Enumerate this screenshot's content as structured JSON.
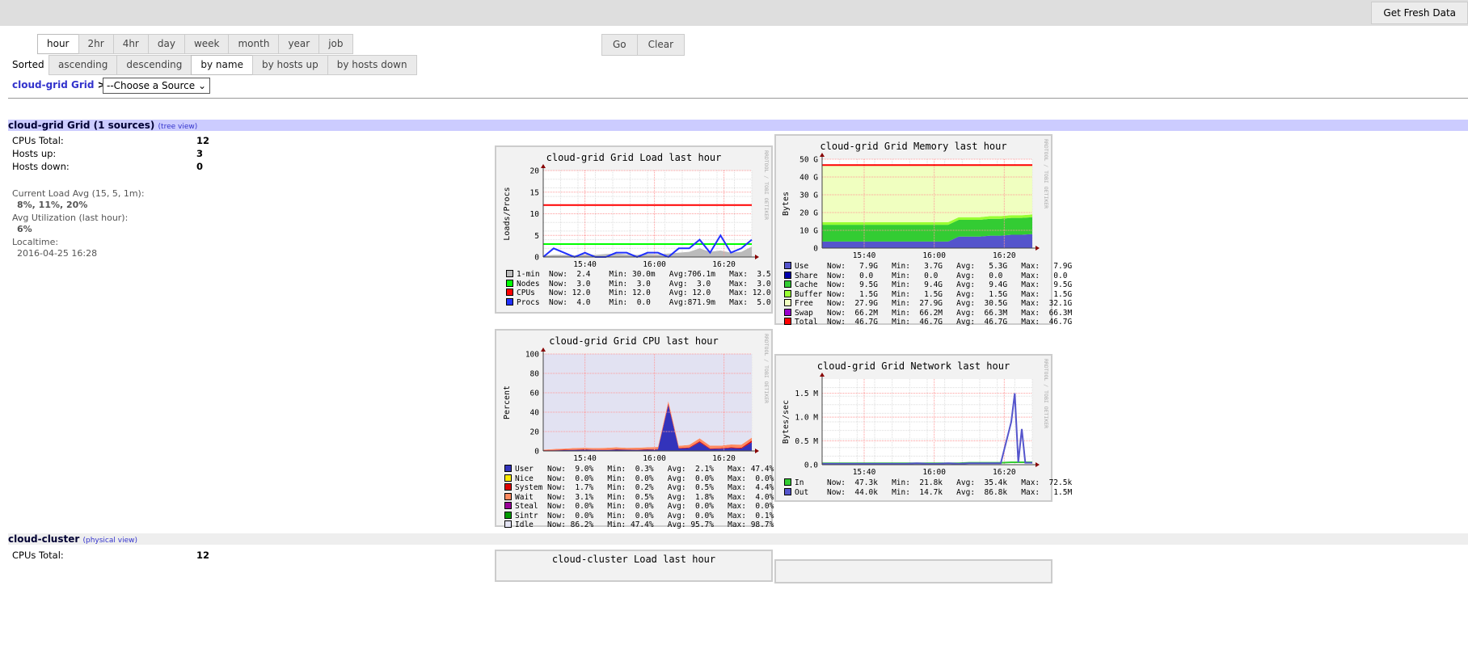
{
  "header": {
    "fresh_label": "Get Fresh Data"
  },
  "time_tabs": [
    "hour",
    "2hr",
    "4hr",
    "day",
    "week",
    "month",
    "year",
    "job"
  ],
  "time_selected": "hour",
  "go_label": "Go",
  "clear_label": "Clear",
  "sort": {
    "label": "Sorted",
    "options": [
      "ascending",
      "descending",
      "by name",
      "by hosts up",
      "by hosts down"
    ],
    "selected": "by name"
  },
  "breadcrumb": {
    "grid": "cloud-grid Grid",
    "sep": ">",
    "source_select": "--Choose a Source"
  },
  "grid_section": {
    "title": "cloud-grid Grid (1 sources)",
    "link": "(tree view)",
    "cpus_label": "CPUs Total:",
    "cpus": "12",
    "up_label": "Hosts up:",
    "up": "3",
    "down_label": "Hosts down:",
    "down": "0",
    "load_label": "Current Load Avg (15, 5, 1m):",
    "load": "8%, 11%, 20%",
    "util_label": "Avg Utilization (last hour):",
    "util": "6%",
    "time_label": "Localtime:",
    "time": "2016-04-25 16:28"
  },
  "cluster_section": {
    "title": "cloud-cluster",
    "link": "(physical view)",
    "cpus_label": "CPUs Total:",
    "cpus": "12",
    "chart_title": "cloud-cluster Load last hour"
  },
  "watermark": "RRDTOOL / TOBI OETIKER",
  "chart_data": [
    {
      "type": "line",
      "title": "cloud-grid Grid Load last hour",
      "ylabel": "Loads/Procs",
      "ylim": [
        0,
        20
      ],
      "yticks": [
        {
          "v": 0,
          "l": "0"
        },
        {
          "v": 5,
          "l": "5"
        },
        {
          "v": 10,
          "l": "10"
        },
        {
          "v": 15,
          "l": "15"
        },
        {
          "v": 20,
          "l": "20"
        }
      ],
      "xlim": [
        "15:28",
        "16:28"
      ],
      "xticks": [
        "15:40",
        "16:00",
        "16:20"
      ],
      "x": [
        "15:28",
        "15:31",
        "15:34",
        "15:37",
        "15:40",
        "15:43",
        "15:46",
        "15:49",
        "15:52",
        "15:55",
        "15:58",
        "16:01",
        "16:04",
        "16:07",
        "16:10",
        "16:13",
        "16:16",
        "16:19",
        "16:22",
        "16:25",
        "16:28"
      ],
      "series": [
        {
          "name": "1-min",
          "color": "#bbbbbb",
          "kind": "area",
          "values": [
            0.3,
            0.5,
            0.5,
            0.4,
            0.6,
            0.5,
            0.7,
            0.8,
            0.6,
            0.5,
            0.7,
            0.6,
            0.8,
            1.0,
            1.2,
            2.0,
            1.2,
            1.5,
            1.0,
            1.2,
            2.4
          ],
          "legend": "1-min  Now:  2.4    Min: 30.0m   Avg:706.1m   Max:  3.5"
        },
        {
          "name": "Nodes",
          "color": "#00ff00",
          "kind": "line",
          "values": [
            3,
            3,
            3,
            3,
            3,
            3,
            3,
            3,
            3,
            3,
            3,
            3,
            3,
            3,
            3,
            3,
            3,
            3,
            3,
            3,
            3
          ],
          "legend": "Nodes  Now:  3.0    Min:  3.0    Avg:  3.0    Max:  3.0"
        },
        {
          "name": "CPUs",
          "color": "#ff0000",
          "kind": "line",
          "values": [
            12,
            12,
            12,
            12,
            12,
            12,
            12,
            12,
            12,
            12,
            12,
            12,
            12,
            12,
            12,
            12,
            12,
            12,
            12,
            12,
            12
          ],
          "legend": "CPUs   Now: 12.0    Min: 12.0    Avg: 12.0    Max: 12.0"
        },
        {
          "name": "Procs",
          "color": "#2030ff",
          "kind": "line",
          "values": [
            0,
            2,
            1,
            0,
            1,
            0,
            0,
            1,
            1,
            0,
            1,
            1,
            0,
            2,
            2,
            4,
            1,
            5,
            1,
            2,
            4
          ],
          "legend": "Procs  Now:  4.0    Min:  0.0    Avg:871.9m   Max:  5.0"
        }
      ]
    },
    {
      "type": "area",
      "title": "cloud-grid Grid Memory last hour",
      "ylabel": "Bytes",
      "ylim": [
        0,
        50
      ],
      "yticks": [
        {
          "v": 0,
          "l": "0"
        },
        {
          "v": 10,
          "l": "10 G"
        },
        {
          "v": 20,
          "l": "20 G"
        },
        {
          "v": 30,
          "l": "30 G"
        },
        {
          "v": 40,
          "l": "40 G"
        },
        {
          "v": 50,
          "l": "50 G"
        }
      ],
      "xlim": [
        "15:28",
        "16:28"
      ],
      "xticks": [
        "15:40",
        "16:00",
        "16:20"
      ],
      "x": [
        "15:28",
        "15:31",
        "15:34",
        "15:37",
        "15:40",
        "15:43",
        "15:46",
        "15:49",
        "15:52",
        "15:55",
        "15:58",
        "16:01",
        "16:04",
        "16:07",
        "16:10",
        "16:13",
        "16:16",
        "16:19",
        "16:22",
        "16:25",
        "16:28"
      ],
      "series": [
        {
          "name": "Use",
          "color": "#5555cc",
          "kind": "stack",
          "values": [
            3.7,
            3.7,
            3.7,
            3.7,
            3.7,
            3.7,
            3.7,
            3.7,
            3.7,
            3.7,
            3.7,
            3.7,
            3.7,
            6.5,
            6.5,
            6.5,
            7.0,
            7.0,
            7.5,
            7.5,
            7.9
          ],
          "legend": "Use    Now:   7.9G   Min:   3.7G   Avg:   5.3G   Max:   7.9G"
        },
        {
          "name": "Share",
          "color": "#0000aa",
          "kind": "stack",
          "values": [
            0,
            0,
            0,
            0,
            0,
            0,
            0,
            0,
            0,
            0,
            0,
            0,
            0,
            0,
            0,
            0,
            0,
            0,
            0,
            0,
            0
          ],
          "legend": "Share  Now:   0.0    Min:   0.0    Avg:   0.0    Max:   0.0"
        },
        {
          "name": "Cache",
          "color": "#33cc33",
          "kind": "stack",
          "values": [
            9.4,
            9.4,
            9.4,
            9.4,
            9.4,
            9.4,
            9.4,
            9.4,
            9.4,
            9.4,
            9.4,
            9.4,
            9.4,
            9.4,
            9.4,
            9.4,
            9.5,
            9.5,
            9.5,
            9.5,
            9.5
          ],
          "legend": "Cache  Now:   9.5G   Min:   9.4G   Avg:   9.4G   Max:   9.5G"
        },
        {
          "name": "Buffer",
          "color": "#99ff33",
          "kind": "stack",
          "values": [
            1.5,
            1.5,
            1.5,
            1.5,
            1.5,
            1.5,
            1.5,
            1.5,
            1.5,
            1.5,
            1.5,
            1.5,
            1.5,
            1.5,
            1.5,
            1.5,
            1.5,
            1.5,
            1.5,
            1.5,
            1.5
          ],
          "legend": "Buffer Now:   1.5G   Min:   1.5G   Avg:   1.5G   Max:   1.5G"
        },
        {
          "name": "Free",
          "color": "#f0ffc0",
          "kind": "stack",
          "values": [
            32.1,
            32.1,
            32.1,
            32.1,
            32.1,
            32.1,
            32.1,
            32.1,
            32.1,
            32.1,
            32.1,
            32.1,
            32.1,
            29.3,
            29.3,
            29.3,
            28.7,
            28.7,
            28.2,
            28.2,
            27.9
          ],
          "legend": "Free   Now:  27.9G   Min:  27.9G   Avg:  30.5G   Max:  32.1G"
        },
        {
          "name": "Swap",
          "color": "#9900cc",
          "kind": "stack",
          "values": [
            0,
            0,
            0,
            0,
            0,
            0,
            0,
            0,
            0,
            0,
            0,
            0,
            0,
            0,
            0,
            0,
            0,
            0,
            0,
            0,
            0
          ],
          "legend": "Swap   Now:  66.2M   Min:  66.2M   Avg:  66.3M   Max:  66.3M"
        },
        {
          "name": "Total",
          "color": "#ff0000",
          "kind": "line",
          "values": [
            46.7,
            46.7,
            46.7,
            46.7,
            46.7,
            46.7,
            46.7,
            46.7,
            46.7,
            46.7,
            46.7,
            46.7,
            46.7,
            46.7,
            46.7,
            46.7,
            46.7,
            46.7,
            46.7,
            46.7,
            46.7
          ],
          "legend": "Total  Now:  46.7G   Min:  46.7G   Avg:  46.7G   Max:  46.7G"
        }
      ]
    },
    {
      "type": "area",
      "title": "cloud-grid Grid CPU last hour",
      "ylabel": "Percent",
      "ylim": [
        0,
        100
      ],
      "yticks": [
        {
          "v": 0,
          "l": "0"
        },
        {
          "v": 20,
          "l": "20"
        },
        {
          "v": 40,
          "l": "40"
        },
        {
          "v": 60,
          "l": "60"
        },
        {
          "v": 80,
          "l": "80"
        },
        {
          "v": 100,
          "l": "100"
        }
      ],
      "xlim": [
        "15:28",
        "16:28"
      ],
      "xticks": [
        "15:40",
        "16:00",
        "16:20"
      ],
      "x": [
        "15:28",
        "15:31",
        "15:34",
        "15:37",
        "15:40",
        "15:43",
        "15:46",
        "15:49",
        "15:52",
        "15:55",
        "15:58",
        "16:01",
        "16:04",
        "16:07",
        "16:10",
        "16:13",
        "16:16",
        "16:19",
        "16:22",
        "16:25",
        "16:28"
      ],
      "series": [
        {
          "name": "User",
          "color": "#3333bb",
          "kind": "stack",
          "values": [
            0.5,
            0.6,
            0.8,
            1.0,
            1.2,
            1.0,
            0.9,
            1.2,
            1.1,
            1.0,
            1.3,
            1.5,
            47.4,
            2.5,
            3.0,
            9.0,
            2.0,
            2.2,
            3.0,
            2.5,
            9.0
          ],
          "legend": "User   Now:  9.0%   Min:  0.3%   Avg:  2.1%   Max: 47.4%"
        },
        {
          "name": "Nice",
          "color": "#ffea00",
          "kind": "stack",
          "values": [
            0,
            0,
            0,
            0,
            0,
            0,
            0,
            0,
            0,
            0,
            0,
            0,
            0,
            0,
            0,
            0,
            0,
            0,
            0,
            0,
            0
          ],
          "legend": "Nice   Now:  0.0%   Min:  0.0%   Avg:  0.0%   Max:  0.0%"
        },
        {
          "name": "System",
          "color": "#dd0000",
          "kind": "stack",
          "values": [
            0.3,
            0.4,
            0.4,
            0.5,
            0.5,
            0.4,
            0.5,
            0.5,
            0.5,
            0.5,
            0.5,
            0.5,
            1.5,
            0.6,
            0.6,
            1.0,
            0.6,
            0.6,
            0.7,
            0.8,
            1.7
          ],
          "legend": "System Now:  1.7%   Min:  0.2%   Avg:  0.5%   Max:  4.4%"
        },
        {
          "name": "Wait",
          "color": "#ff8a60",
          "kind": "stack",
          "values": [
            0.6,
            1.0,
            1.2,
            1.5,
            1.6,
            1.5,
            1.8,
            2.0,
            1.6,
            1.8,
            2.0,
            2.2,
            2.5,
            2.2,
            2.6,
            3.0,
            2.8,
            2.6,
            3.0,
            3.2,
            3.1
          ],
          "legend": "Wait   Now:  3.1%   Min:  0.5%   Avg:  1.8%   Max:  4.0%"
        },
        {
          "name": "Steal",
          "color": "#990099",
          "kind": "stack",
          "values": [
            0,
            0,
            0,
            0,
            0,
            0,
            0,
            0,
            0,
            0,
            0,
            0,
            0,
            0,
            0,
            0,
            0,
            0,
            0,
            0,
            0
          ],
          "legend": "Steal  Now:  0.0%   Min:  0.0%   Avg:  0.0%   Max:  0.0%"
        },
        {
          "name": "Sintr",
          "color": "#009900",
          "kind": "stack",
          "values": [
            0,
            0,
            0,
            0,
            0,
            0,
            0,
            0,
            0,
            0,
            0,
            0,
            0,
            0,
            0,
            0,
            0,
            0,
            0,
            0,
            0
          ],
          "legend": "Sintr  Now:  0.0%   Min:  0.0%   Avg:  0.0%   Max:  0.1%"
        },
        {
          "name": "Idle",
          "color": "#e2e2f2",
          "kind": "stack",
          "values": [
            98.6,
            98.0,
            97.6,
            97.0,
            96.7,
            97.1,
            96.8,
            96.3,
            96.8,
            96.7,
            96.2,
            95.8,
            48.6,
            94.7,
            93.8,
            87.0,
            94.6,
            94.6,
            93.3,
            93.5,
            86.2
          ],
          "legend": "Idle   Now: 86.2%   Min: 47.4%   Avg: 95.7%   Max: 98.7%"
        }
      ]
    },
    {
      "type": "line",
      "title": "cloud-grid Grid Network last hour",
      "ylabel": "Bytes/sec",
      "ylim": [
        0,
        1.8
      ],
      "yticks": [
        {
          "v": 0,
          "l": "0.0"
        },
        {
          "v": 0.5,
          "l": "0.5 M"
        },
        {
          "v": 1.0,
          "l": "1.0 M"
        },
        {
          "v": 1.5,
          "l": "1.5 M"
        }
      ],
      "xlim": [
        "15:28",
        "16:28"
      ],
      "xticks": [
        "15:40",
        "16:00",
        "16:20"
      ],
      "x": [
        "15:28",
        "15:31",
        "15:34",
        "15:37",
        "15:40",
        "15:43",
        "15:46",
        "15:49",
        "15:52",
        "15:55",
        "15:58",
        "16:01",
        "16:04",
        "16:07",
        "16:10",
        "16:13",
        "16:16",
        "16:19",
        "16:22",
        "16:23",
        "16:24",
        "16:25",
        "16:26",
        "16:28"
      ],
      "series": [
        {
          "name": "In",
          "color": "#33cc33",
          "kind": "line",
          "values": [
            0.03,
            0.03,
            0.03,
            0.03,
            0.03,
            0.03,
            0.03,
            0.03,
            0.03,
            0.03,
            0.03,
            0.03,
            0.03,
            0.03,
            0.04,
            0.04,
            0.04,
            0.04,
            0.05,
            0.05,
            0.05,
            0.05,
            0.05,
            0.05
          ],
          "legend": "In     Now:  47.3k   Min:  21.8k   Avg:  35.4k   Max:  72.5k"
        },
        {
          "name": "Out",
          "color": "#5555cc",
          "kind": "line",
          "values": [
            0.02,
            0.02,
            0.02,
            0.02,
            0.02,
            0.02,
            0.02,
            0.02,
            0.02,
            0.03,
            0.02,
            0.02,
            0.03,
            0.02,
            0.03,
            0.03,
            0.03,
            0.03,
            0.9,
            1.5,
            0.05,
            0.75,
            0.04,
            0.04
          ],
          "legend": "Out    Now:  44.0k   Min:  14.7k   Avg:  86.8k   Max:   1.5M"
        }
      ]
    }
  ]
}
